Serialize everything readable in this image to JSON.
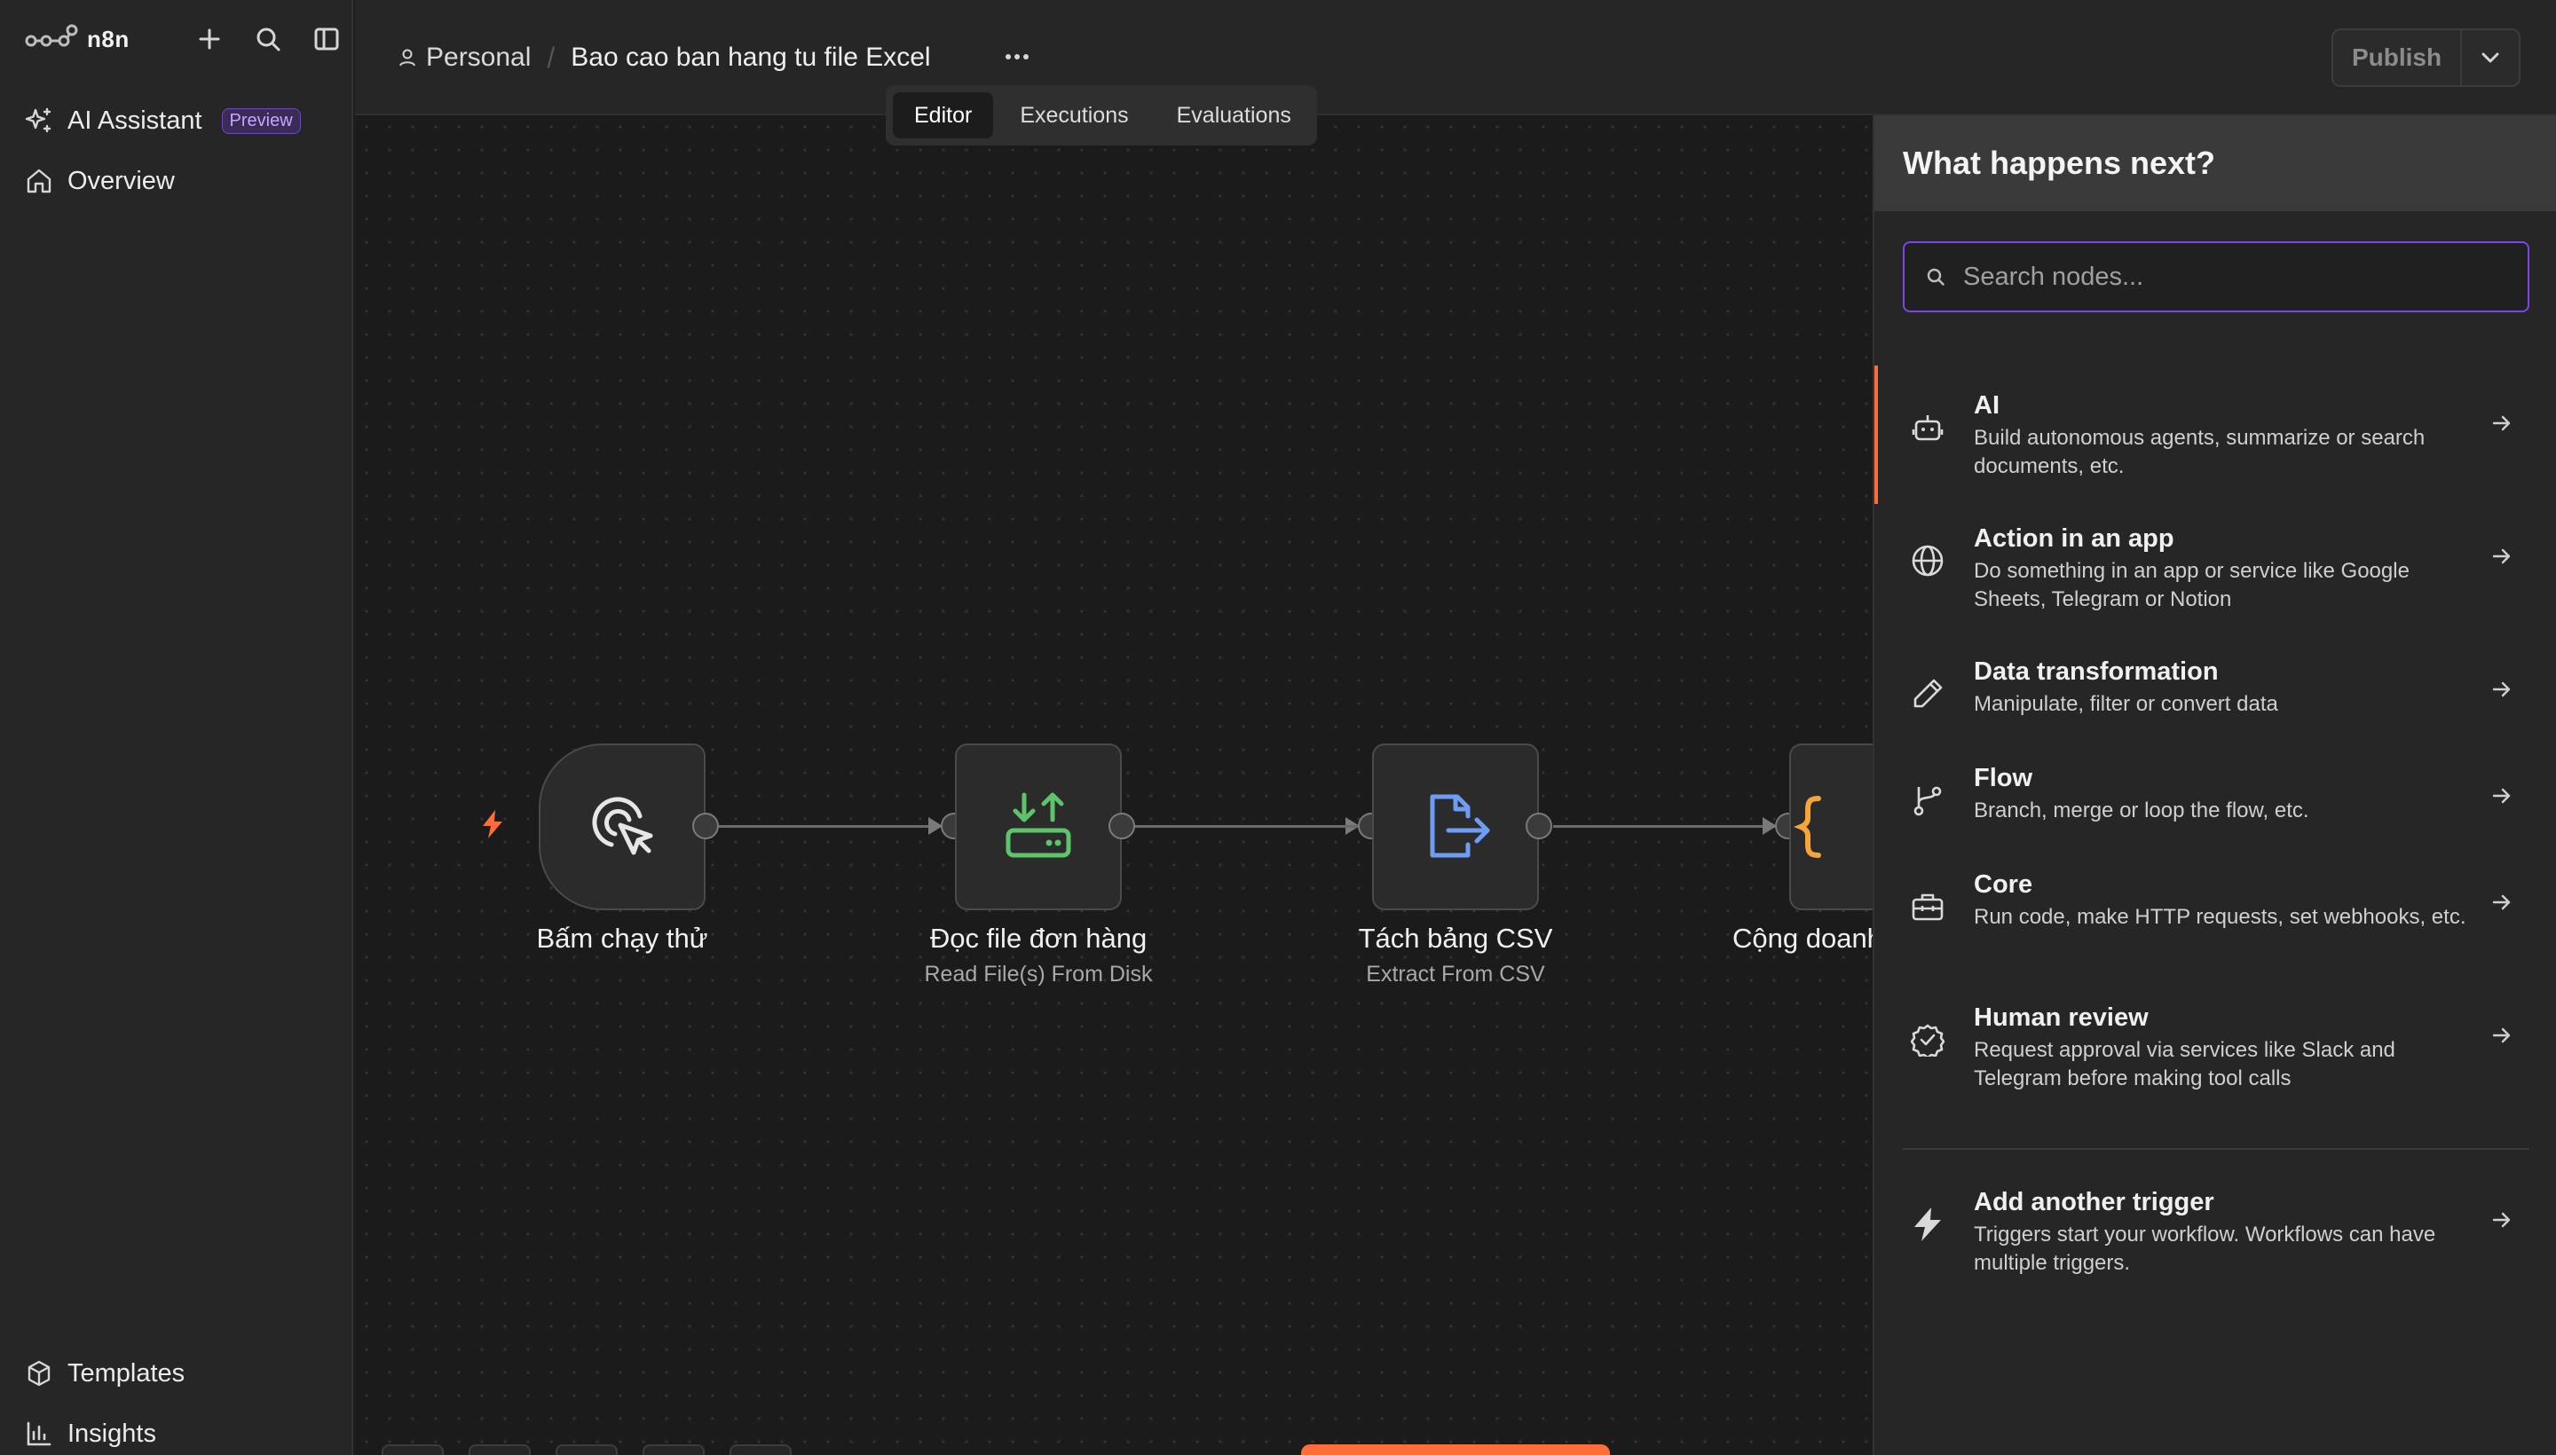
{
  "app": {
    "name": "n8n"
  },
  "sidebar": {
    "items": [
      {
        "label": "AI Assistant",
        "badge": "Preview"
      },
      {
        "label": "Overview"
      }
    ],
    "bottom_items": [
      {
        "label": "Templates"
      },
      {
        "label": "Insights"
      }
    ]
  },
  "header": {
    "project": "Personal",
    "workflow_title": "Bao cao ban hang tu file Excel",
    "tabs": [
      {
        "label": "Editor",
        "active": true
      },
      {
        "label": "Executions",
        "active": false
      },
      {
        "label": "Evaluations",
        "active": false
      }
    ],
    "publish_label": "Publish"
  },
  "canvas": {
    "nodes": [
      {
        "title": "Bấm chạy thử",
        "subtitle": "",
        "icon": "cursor-click-icon"
      },
      {
        "title": "Đọc file đơn hàng",
        "subtitle": "Read File(s) From Disk",
        "icon": "file-transfer-icon",
        "icon_color": "#5cc46a"
      },
      {
        "title": "Tách bảng CSV",
        "subtitle": "Extract From CSV",
        "icon": "file-export-icon",
        "icon_color": "#6f9cf5"
      },
      {
        "title": "Cộng doanh",
        "subtitle": "",
        "icon": "code-braces-icon",
        "icon_color": "#f5a53a"
      }
    ]
  },
  "panel": {
    "title": "What happens next?",
    "search_placeholder": "Search nodes...",
    "categories": [
      {
        "title": "AI",
        "desc": "Build autonomous agents, summarize or search documents, etc.",
        "icon": "robot-icon"
      },
      {
        "title": "Action in an app",
        "desc": "Do something in an app or service like Google Sheets, Telegram or Notion",
        "icon": "globe-icon"
      },
      {
        "title": "Data transformation",
        "desc": "Manipulate, filter or convert data",
        "icon": "pen-icon"
      },
      {
        "title": "Flow",
        "desc": "Branch, merge or loop the flow, etc.",
        "icon": "branch-icon"
      },
      {
        "title": "Core",
        "desc": "Run code, make HTTP requests, set webhooks, etc.",
        "icon": "toolbox-icon"
      },
      {
        "title": "Human review",
        "desc": "Request approval via services like Slack and Telegram before making tool calls",
        "icon": "badge-check-icon"
      }
    ],
    "trigger": {
      "title": "Add another trigger",
      "desc": "Triggers start your workflow. Workflows can have multiple triggers.",
      "icon": "bolt-icon"
    }
  },
  "colors": {
    "accent": "#ff6d3a",
    "search_border": "#7b45e8"
  }
}
